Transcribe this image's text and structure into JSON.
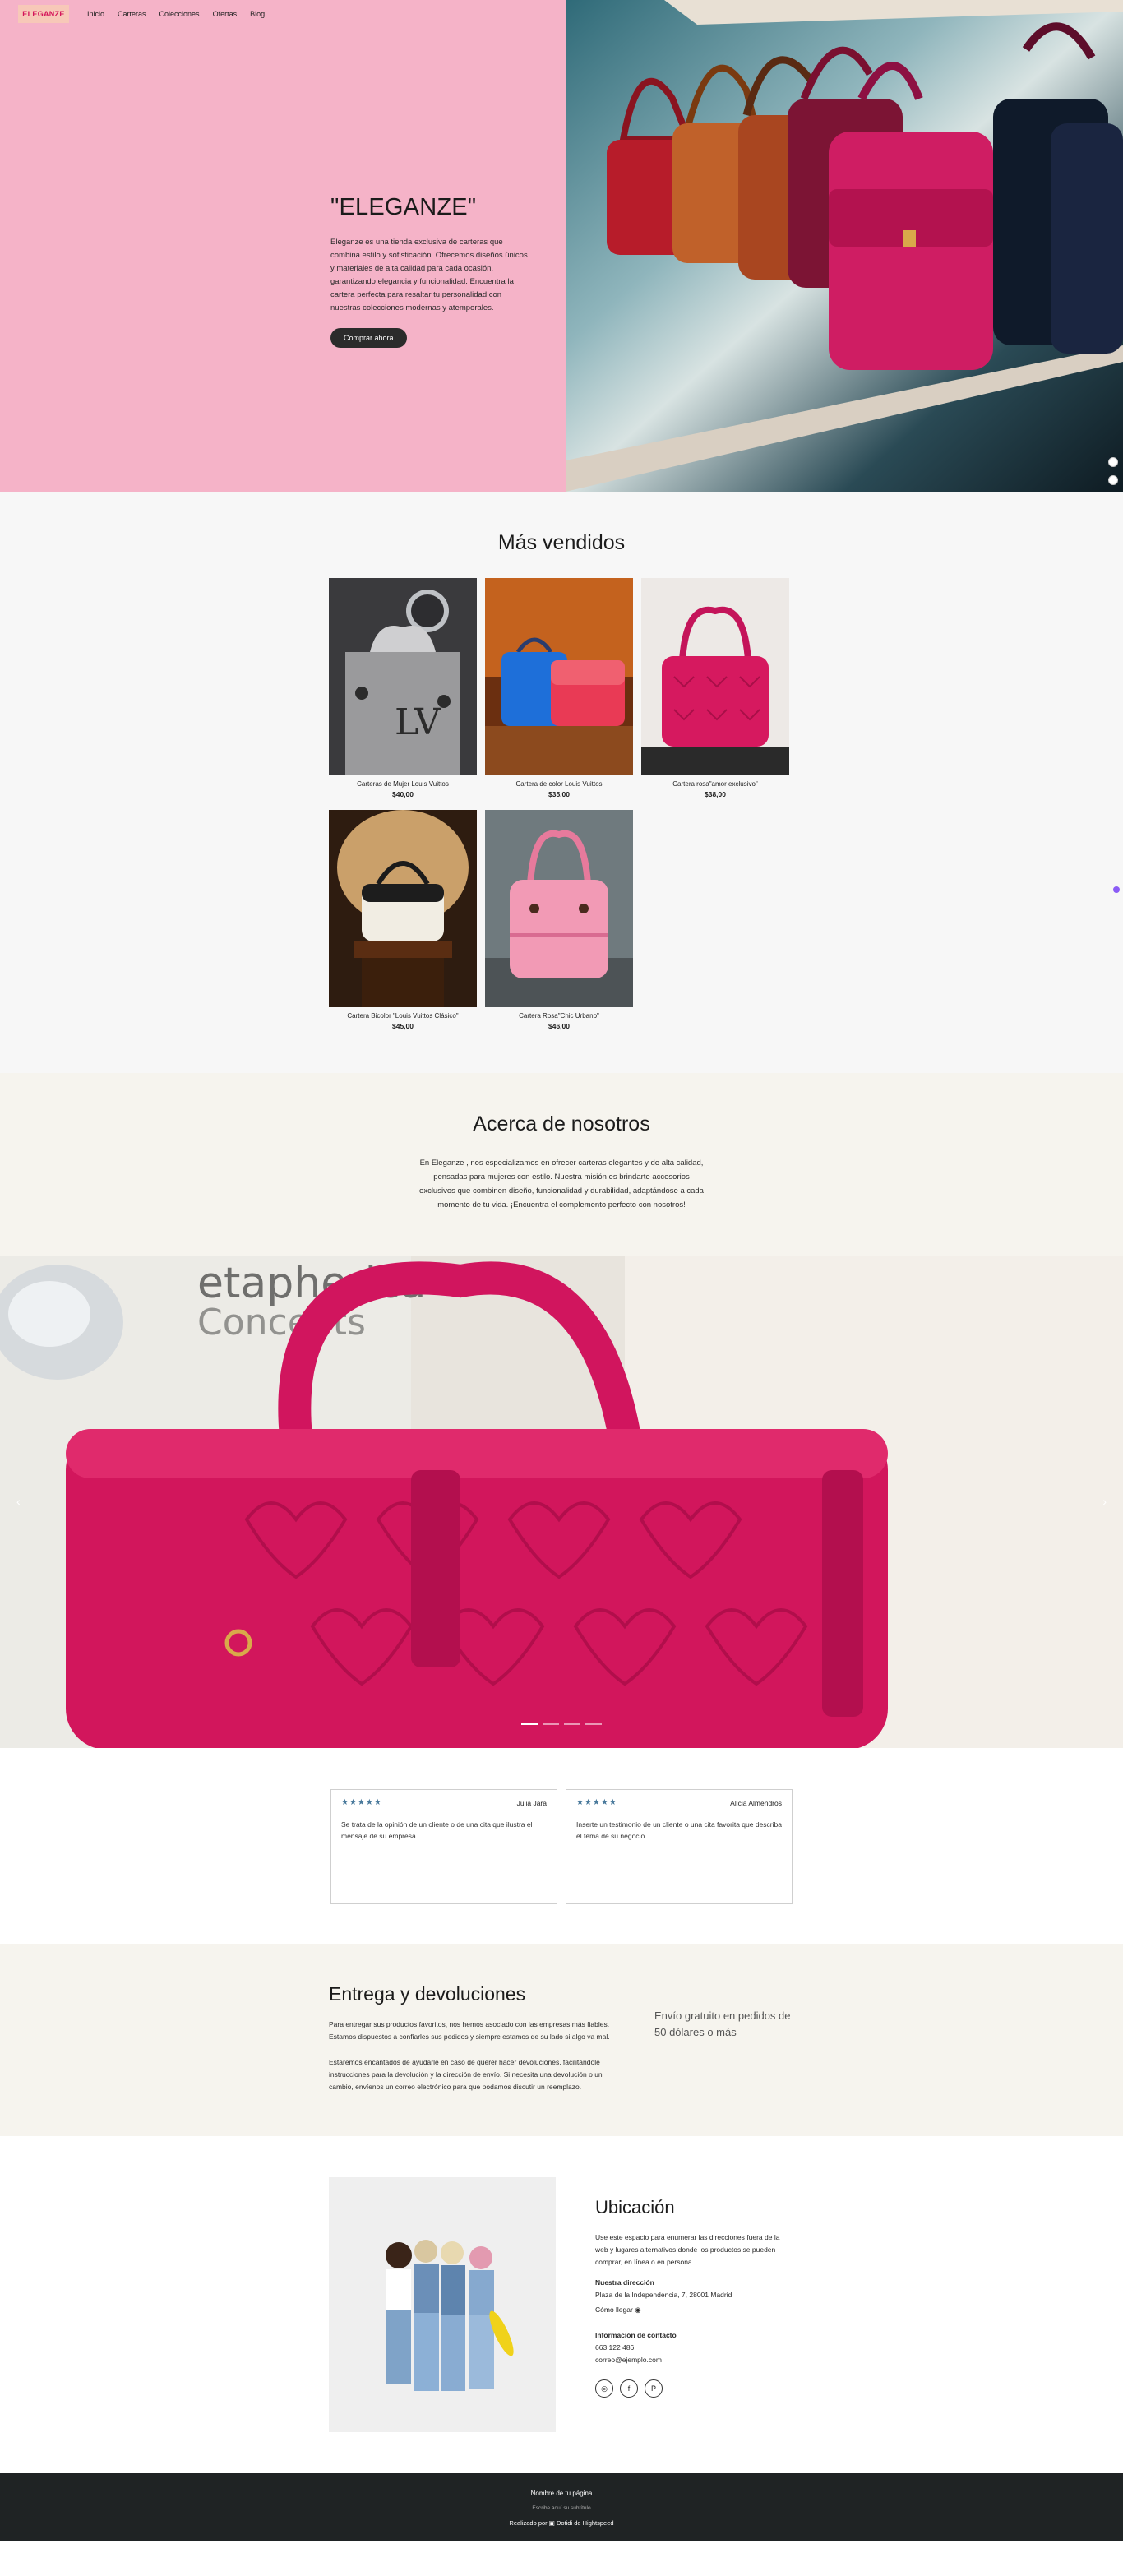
{
  "header": {
    "logo": "ELEGANZE",
    "nav": [
      "Inicio",
      "Carteras",
      "Colecciones",
      "Ofertas",
      "Blog"
    ]
  },
  "hero": {
    "title": "\"ELEGANZE\"",
    "description": "Eleganze es una tienda exclusiva de carteras que combina estilo y sofisticación. Ofrecemos diseños únicos y materiales de alta calidad para cada ocasión, garantizando elegancia y funcionalidad. Encuentra la cartera perfecta para resaltar tu personalidad con nuestras colecciones modernas y atemporales.",
    "button": "Comprar ahora"
  },
  "bestsellers": {
    "title": "Más vendidos",
    "products": [
      {
        "name": "Carteras de Mujer Louis Vuittos",
        "price": "$40,00"
      },
      {
        "name": "Cartera de color Louis Vuittos",
        "price": "$35,00"
      },
      {
        "name": "Cartera rosa\"amor exclusivo\"",
        "price": "$38,00"
      },
      {
        "name": "Cartera Bicolor \"Louis Vuittos Clásico\"",
        "price": "$45,00"
      },
      {
        "name": "Cartera Rosa\"Chic Urbano\"",
        "price": "$46,00"
      }
    ]
  },
  "about": {
    "title": "Acerca de nosotros",
    "text": "En Eleganze , nos especializamos en ofrecer carteras elegantes y de alta calidad, pensadas para mujeres con estilo. Nuestra misión es brindarte accesorios exclusivos que combinen diseño, funcionalidad y durabilidad, adaptándose a cada momento de tu vida. ¡Encuentra el complemento perfecto con nosotros!"
  },
  "reviews": [
    {
      "stars": "★★★★★",
      "name": "Julia Jara",
      "text": "Se trata de la opinión de un cliente o de una cita que ilustra el mensaje de su empresa."
    },
    {
      "stars": "★★★★★",
      "name": "Alicia Almendros",
      "text": "Inserte un testimonio de un cliente o una cita favorita que describa el tema de su negocio."
    }
  ],
  "delivery": {
    "title": "Entrega y devoluciones",
    "p1": "Para entregar sus productos favoritos, nos hemos asociado con las empresas más fiables. Estamos dispuestos a confiarles sus pedidos y siempre estamos de su lado si algo va mal.",
    "p2": "Estaremos encantados de ayudarle en caso de querer hacer devoluciones, facilitándole instrucciones para la devolución y la dirección de envío. Si necesita una devolución o un cambio, envíenos un correo electrónico para que podamos discutir un reemplazo.",
    "promo": "Envío gratuito en pedidos de 50 dólares o más"
  },
  "location": {
    "title": "Ubicación",
    "intro": "Use este espacio para enumerar las direcciones fuera de la web y lugares alternativos donde los productos se pueden comprar, en línea o en persona.",
    "address_label": "Nuestra dirección",
    "address": "Plaza de la Independencia, 7, 28001 Madrid",
    "directions": "Cómo llegar",
    "contact_label": "Información de contacto",
    "phone": "663 122 486",
    "email": "correo@ejemplo.com",
    "socials": [
      "instagram-icon",
      "facebook-icon",
      "pinterest-icon"
    ]
  },
  "footer": {
    "site_name": "Nombre de tu página",
    "subtitle": "Escribe aquí su subtítulo",
    "made_by": "Realizado por  ▣  Dotidi de Hightspeed"
  }
}
